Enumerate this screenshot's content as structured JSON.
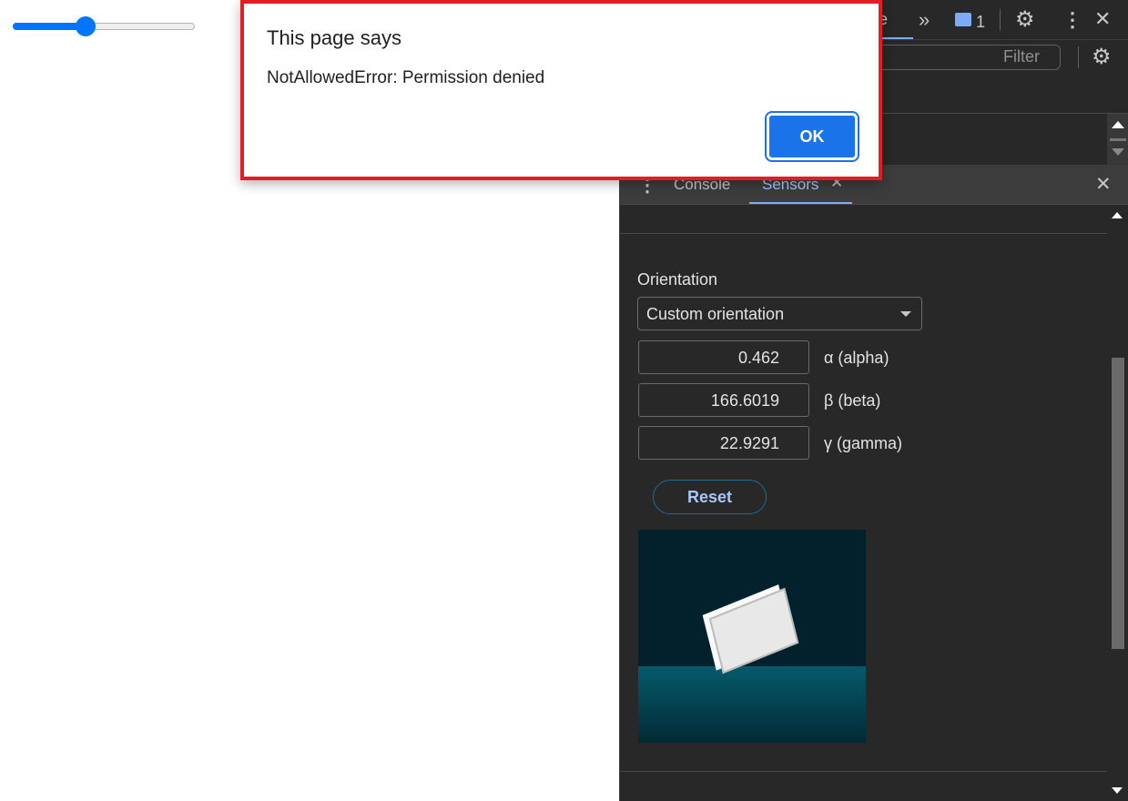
{
  "page": {
    "slider_value_percent": 40
  },
  "dialog": {
    "title": "This page says",
    "message": "NotAllowedError: Permission denied",
    "ok_label": "OK"
  },
  "devtools": {
    "top_tab_partial": "le",
    "more_tabs": "»",
    "issues_count": "1",
    "filter_placeholder": "Filter",
    "drawer": {
      "tabs": [
        {
          "label": "Console"
        },
        {
          "label": "Sensors",
          "active": true
        }
      ]
    },
    "sensors": {
      "orientation_label": "Orientation",
      "orientation_select": "Custom orientation",
      "alpha": {
        "value": "0.462",
        "label": "α (alpha)"
      },
      "beta": {
        "value": "166.6019",
        "label": "β (beta)"
      },
      "gamma": {
        "value": "22.9291",
        "label": "γ (gamma)"
      },
      "reset_label": "Reset"
    }
  },
  "colors": {
    "accent": "#1a73e8",
    "dialog_border": "#e41c24",
    "tab_active": "#a8c7fa"
  }
}
